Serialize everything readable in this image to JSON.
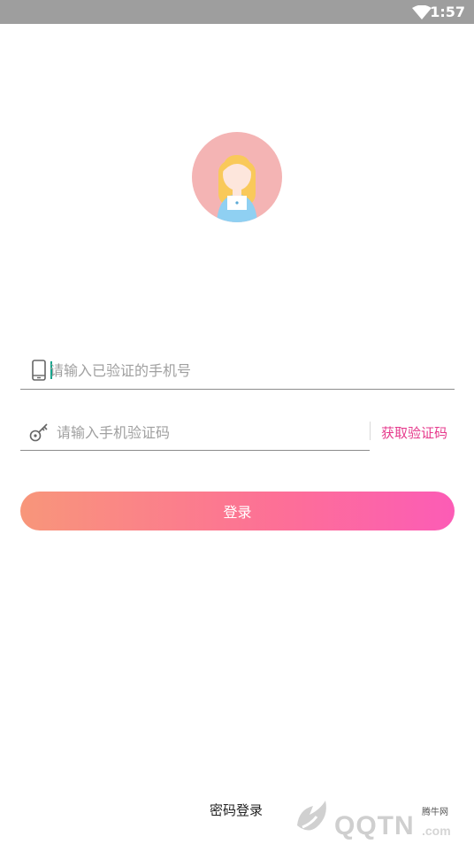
{
  "status_bar": {
    "time": "1:57"
  },
  "phone_field": {
    "placeholder": "请输入已验证的手机号",
    "value": ""
  },
  "code_field": {
    "placeholder": "请输入手机验证码",
    "value": ""
  },
  "get_code_label": "获取验证码",
  "login_label": "登录",
  "password_login_label": "密码登录",
  "watermark": {
    "small": "腾牛网",
    "brand": "QQTN",
    "domain": ".com"
  },
  "colors": {
    "status_bar": "#9e9e9e",
    "accent_pink": "#e6398c",
    "button_start": "#f8967a",
    "button_end": "#fc5cb6",
    "avatar_bg": "#f4b4b4"
  },
  "icons": {
    "avatar": "girl-avatar",
    "phone": "phone-icon",
    "key": "key-icon",
    "wifi": "wifi-icon"
  }
}
